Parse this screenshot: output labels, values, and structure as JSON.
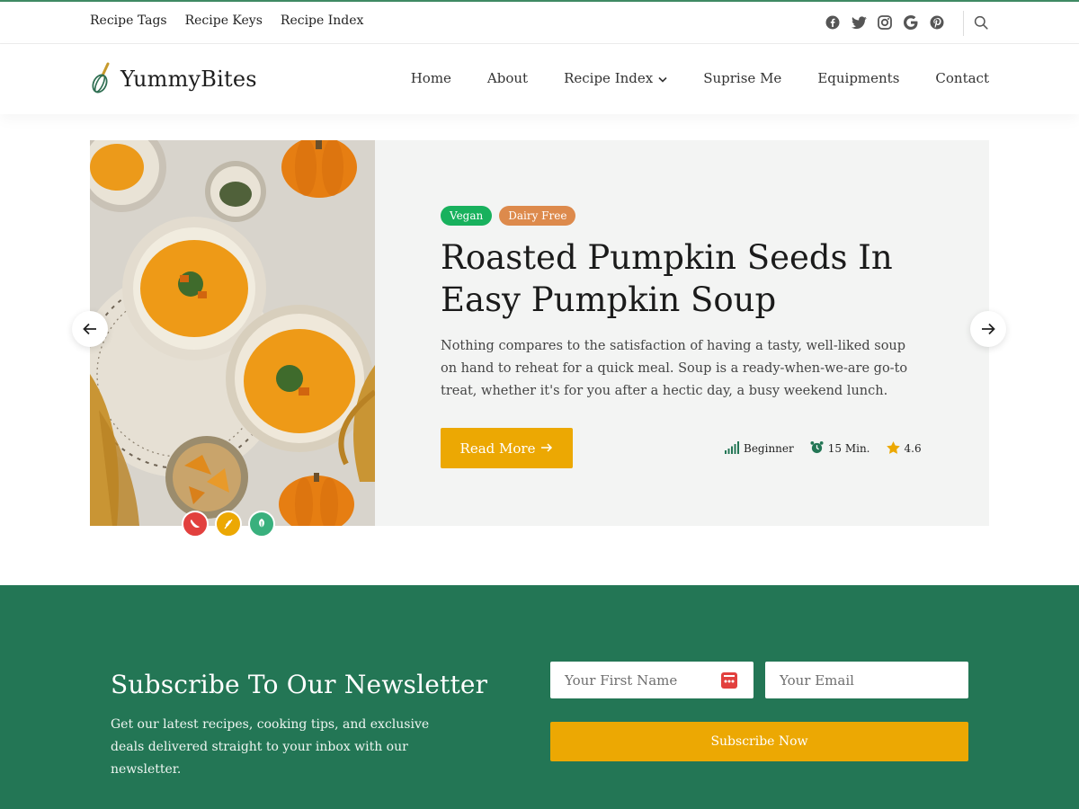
{
  "topbar": {
    "links": [
      "Recipe Tags",
      "Recipe Keys",
      "Recipe Index"
    ],
    "social_icons": [
      "facebook-icon",
      "twitter-icon",
      "instagram-icon",
      "google-icon",
      "pinterest-icon"
    ]
  },
  "header": {
    "logo_text": "YummyBites",
    "nav": [
      "Home",
      "About",
      "Recipe Index",
      "Suprise Me",
      "Equipments",
      "Contact"
    ]
  },
  "hero": {
    "tags": [
      "Vegan",
      "Dairy Free"
    ],
    "title": "Roasted Pumpkin Seeds In Easy Pumpkin Soup",
    "description": "Nothing compares to the satisfaction of having a tasty, well-liked soup on hand to reheat for a quick meal. Soup is a ready-when-we-are go-to treat, whether it's for you after a hectic day, a busy weekend lunch.",
    "read_more": "Read More",
    "difficulty": "Beginner",
    "time": "15 Min.",
    "rating": "4.6"
  },
  "newsletter": {
    "title": "Subscribe To Our Newsletter",
    "description": "Get our latest recipes, cooking tips, and exclusive deals delivered straight to your inbox with our newsletter.",
    "first_name_placeholder": "Your First Name",
    "email_placeholder": "Your Email",
    "subscribe_label": "Subscribe Now"
  },
  "colors": {
    "brand_green": "#237655",
    "accent_yellow": "#eca803",
    "vegan_tag": "#18b15d",
    "dairy_tag": "#dd8a4c"
  }
}
